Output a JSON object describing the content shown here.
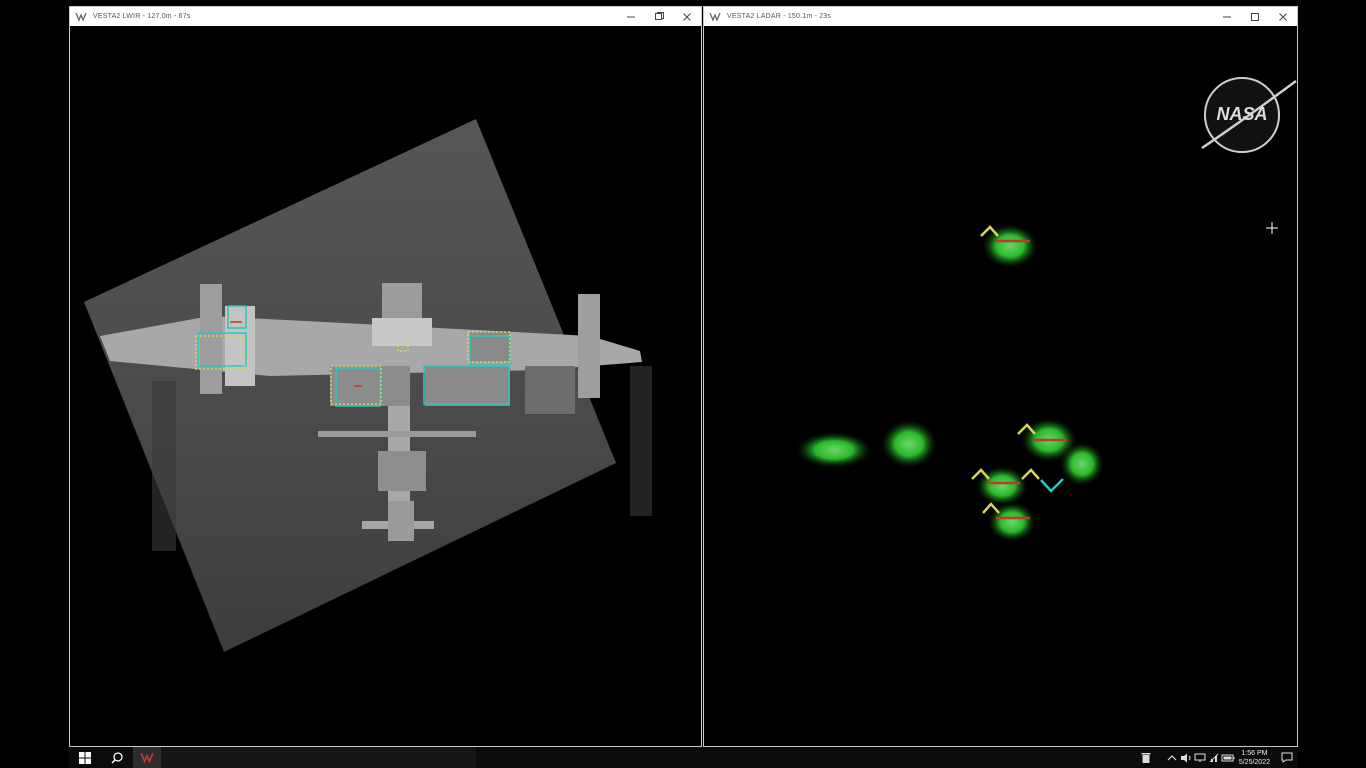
{
  "windows": [
    {
      "title": "VESTA2 LWIR - 127.0m - 67s",
      "app_icon": "vesta-app-icon",
      "controls": [
        "minimize-icon",
        "maximize-icon",
        "close-icon"
      ]
    },
    {
      "title": "VESTA2 LADAR - 150.1m - 23s",
      "app_icon": "vesta-app-icon",
      "controls": [
        "minimize-icon",
        "maximize-icon",
        "close-icon"
      ]
    }
  ],
  "overlay": {
    "logo_text": "NASA",
    "cursor_icon": "crosshair-icon"
  },
  "colors": {
    "titlebar": "#ffffff",
    "window_bg": "#000000",
    "detection_cyan": "#2ec4c0",
    "detection_yellow": "#d7d45a",
    "detection_red": "#c0392b",
    "ladar_green": "#2ab82a",
    "taskbar": "#0b0b0b"
  },
  "taskbar": {
    "start_icon": "windows-start-icon",
    "search_icon": "search-icon",
    "pinned_app_icon": "vesta-app-icon",
    "tray_icons": [
      "recycle-bin-icon",
      "chevron-up-icon",
      "volume-icon",
      "display-icon",
      "network-icon",
      "battery-icon"
    ],
    "time": "1:56 PM",
    "date": "5/25/2022",
    "notification_icon": "notification-icon"
  }
}
